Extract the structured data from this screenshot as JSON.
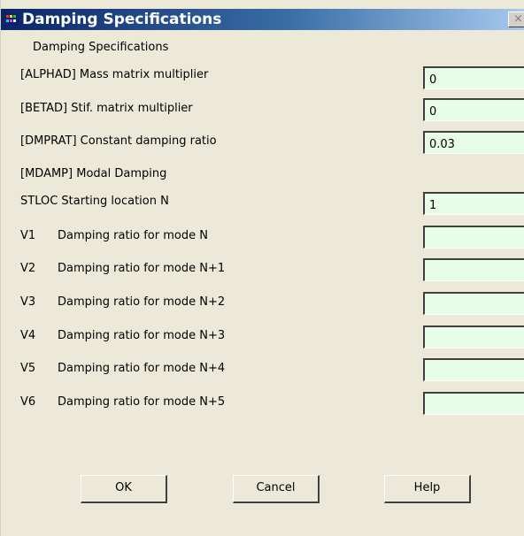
{
  "window": {
    "title": "Damping Specifications",
    "close_glyph": "×",
    "icon": "ansys-app-icon"
  },
  "form": {
    "heading": "Damping Specifications",
    "alphad": {
      "label": "[ALPHAD] Mass matrix multiplier",
      "value": "0"
    },
    "betad": {
      "label": "[BETAD]  Stif. matrix multiplier",
      "value": "0"
    },
    "dmprat": {
      "label": "[DMPRAT] Constant damping ratio",
      "value": "0.03"
    },
    "mdamp": {
      "label": "[MDAMP]  Modal Damping"
    },
    "stloc": {
      "label": "STLOC  Starting location N",
      "value": "1"
    },
    "modes": [
      {
        "id": "V1",
        "label": "Damping ratio for mode N",
        "value": ""
      },
      {
        "id": "V2",
        "label": "Damping ratio for mode N+1",
        "value": ""
      },
      {
        "id": "V3",
        "label": "Damping ratio for mode N+2",
        "value": ""
      },
      {
        "id": "V4",
        "label": "Damping ratio for mode N+3",
        "value": ""
      },
      {
        "id": "V5",
        "label": "Damping ratio for mode N+4",
        "value": ""
      },
      {
        "id": "V6",
        "label": "Damping ratio for mode N+5",
        "value": ""
      }
    ]
  },
  "buttons": {
    "ok": "OK",
    "cancel": "Cancel",
    "help": "Help"
  },
  "colors": {
    "input_bg": "#e8fde8",
    "dialog_bg": "#ece9d8",
    "titlebar": "#0a246a"
  }
}
